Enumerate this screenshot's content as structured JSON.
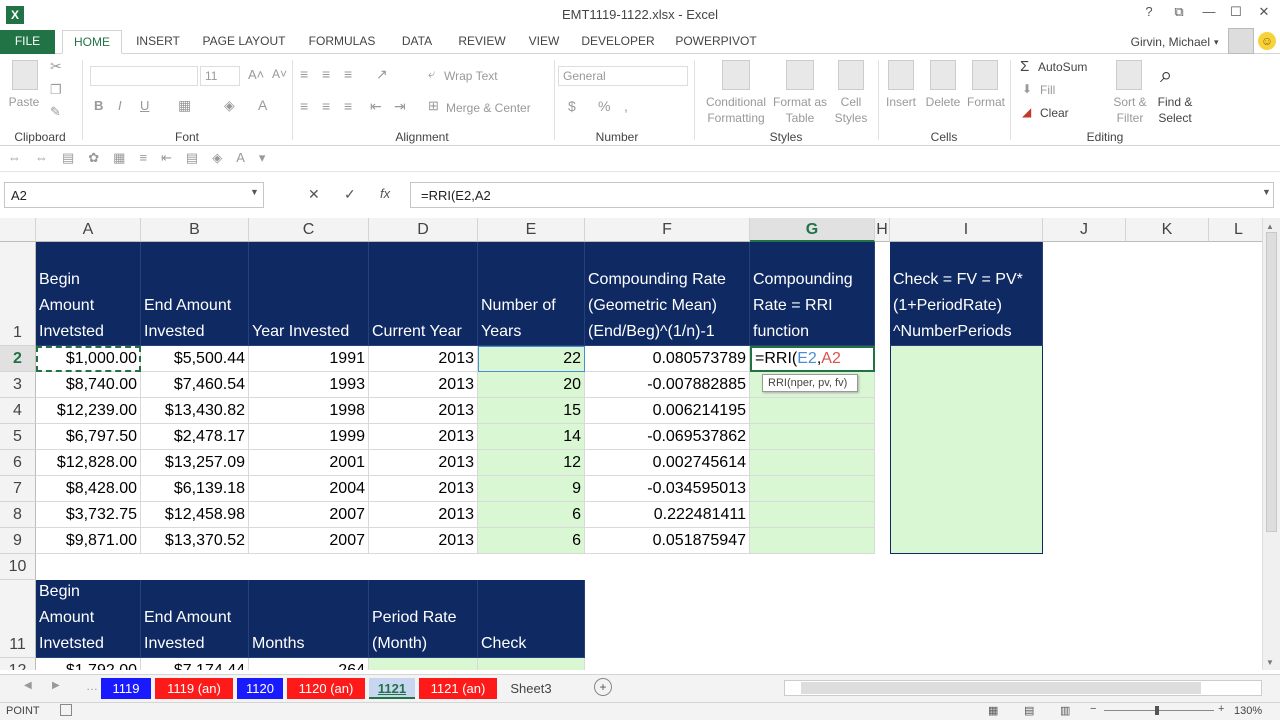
{
  "window": {
    "title": "EMT1119-1122.xlsx - Excel",
    "help": "?",
    "restore_ribbon": "⧉",
    "minimize": "—",
    "maximize": "☐",
    "close": "✕"
  },
  "ribbon_tabs": [
    "FILE",
    "HOME",
    "INSERT",
    "PAGE LAYOUT",
    "FORMULAS",
    "DATA",
    "REVIEW",
    "VIEW",
    "DEVELOPER",
    "POWERPIVOT"
  ],
  "user": {
    "name": "Girvin, Michael"
  },
  "ribbon": {
    "clipboard": {
      "label": "Clipboard",
      "paste": "Paste"
    },
    "font": {
      "label": "Font",
      "size": "11",
      "bold": "B",
      "italic": "I",
      "underline": "U"
    },
    "alignment": {
      "label": "Alignment",
      "wrap": "Wrap Text",
      "merge": "Merge & Center"
    },
    "number": {
      "label": "Number",
      "format": "General",
      "currency": "$",
      "percent": "%",
      "comma": ","
    },
    "styles": {
      "label": "Styles",
      "conditional": "Conditional\nFormatting",
      "format_table": "Format as\nTable",
      "cell_styles": "Cell\nStyles"
    },
    "cells": {
      "label": "Cells",
      "insert": "Insert",
      "delete": "Delete",
      "format": "Format"
    },
    "editing": {
      "label": "Editing",
      "autosum": "AutoSum",
      "fill": "Fill",
      "clear": "Clear",
      "sort": "Sort &\nFilter",
      "find": "Find &\nSelect"
    }
  },
  "formula_bar": {
    "name_box": "A2",
    "fx": "fx",
    "cancel": "✕",
    "enter": "✓",
    "formula": "=RRI(E2,A2"
  },
  "columns": [
    "A",
    "B",
    "C",
    "D",
    "E",
    "F",
    "G",
    "H",
    "I",
    "J",
    "K",
    "L"
  ],
  "rows": [
    "1",
    "2",
    "3",
    "4",
    "5",
    "6",
    "7",
    "8",
    "9",
    "10",
    "11",
    "12"
  ],
  "table1": {
    "headers": [
      "Begin Amount Invetsted",
      "End Amount Invested",
      "Year Invested",
      "Current Year",
      "Number of Years",
      "Compounding Rate (Geometric Mean) (End/Beg)^(1/n)-1",
      "Compounding Rate = RRI function",
      "",
      "Check = FV = PV*(1+PeriodRate) ^NumberPeriods"
    ],
    "data": [
      [
        "$1,000.00",
        "$5,500.44",
        "1991",
        "2013",
        "22",
        "0.080573789"
      ],
      [
        "$8,740.00",
        "$7,460.54",
        "1993",
        "2013",
        "20",
        "-0.007882885"
      ],
      [
        "$12,239.00",
        "$13,430.82",
        "1998",
        "2013",
        "15",
        "0.006214195"
      ],
      [
        "$6,797.50",
        "$2,478.17",
        "1999",
        "2013",
        "14",
        "-0.069537862"
      ],
      [
        "$12,828.00",
        "$13,257.09",
        "2001",
        "2013",
        "12",
        "0.002745614"
      ],
      [
        "$8,428.00",
        "$6,139.18",
        "2004",
        "2013",
        "9",
        "-0.034595013"
      ],
      [
        "$3,732.75",
        "$12,458.98",
        "2007",
        "2013",
        "6",
        "0.222481411"
      ],
      [
        "$9,871.00",
        "$13,370.52",
        "2007",
        "2013",
        "6",
        "0.051875947"
      ]
    ],
    "edit_text": {
      "fn": "=RRI(",
      "arg1": "E2",
      "sep": ",",
      "arg2": "A2"
    },
    "tooltip": "RRI(nper, pv, fv)"
  },
  "table2": {
    "headers": [
      "Begin Amount Invetsted",
      "End Amount Invested",
      "Months",
      "Period Rate (Month)",
      "Check"
    ],
    "partial_row": [
      "$1,792.00",
      "$7,174.44",
      "264"
    ]
  },
  "sheet_tabs": [
    {
      "label": "1119",
      "color": "#1a1aff"
    },
    {
      "label": "1119 (an)",
      "color": "#ff1a1a"
    },
    {
      "label": "1120",
      "color": "#1a1aff"
    },
    {
      "label": "1120 (an)",
      "color": "#ff1a1a"
    },
    {
      "label": "1121",
      "color": "#c9d6f2"
    },
    {
      "label": "1121 (an)",
      "color": "#ff1a1a"
    },
    {
      "label": "Sheet3",
      "color": "#f3f3f3"
    }
  ],
  "status": {
    "mode": "POINT",
    "zoom": "130%"
  },
  "colors": {
    "header_fill": "#0f2a63",
    "green_fill": "#d9f7d3",
    "accent": "#217346"
  }
}
